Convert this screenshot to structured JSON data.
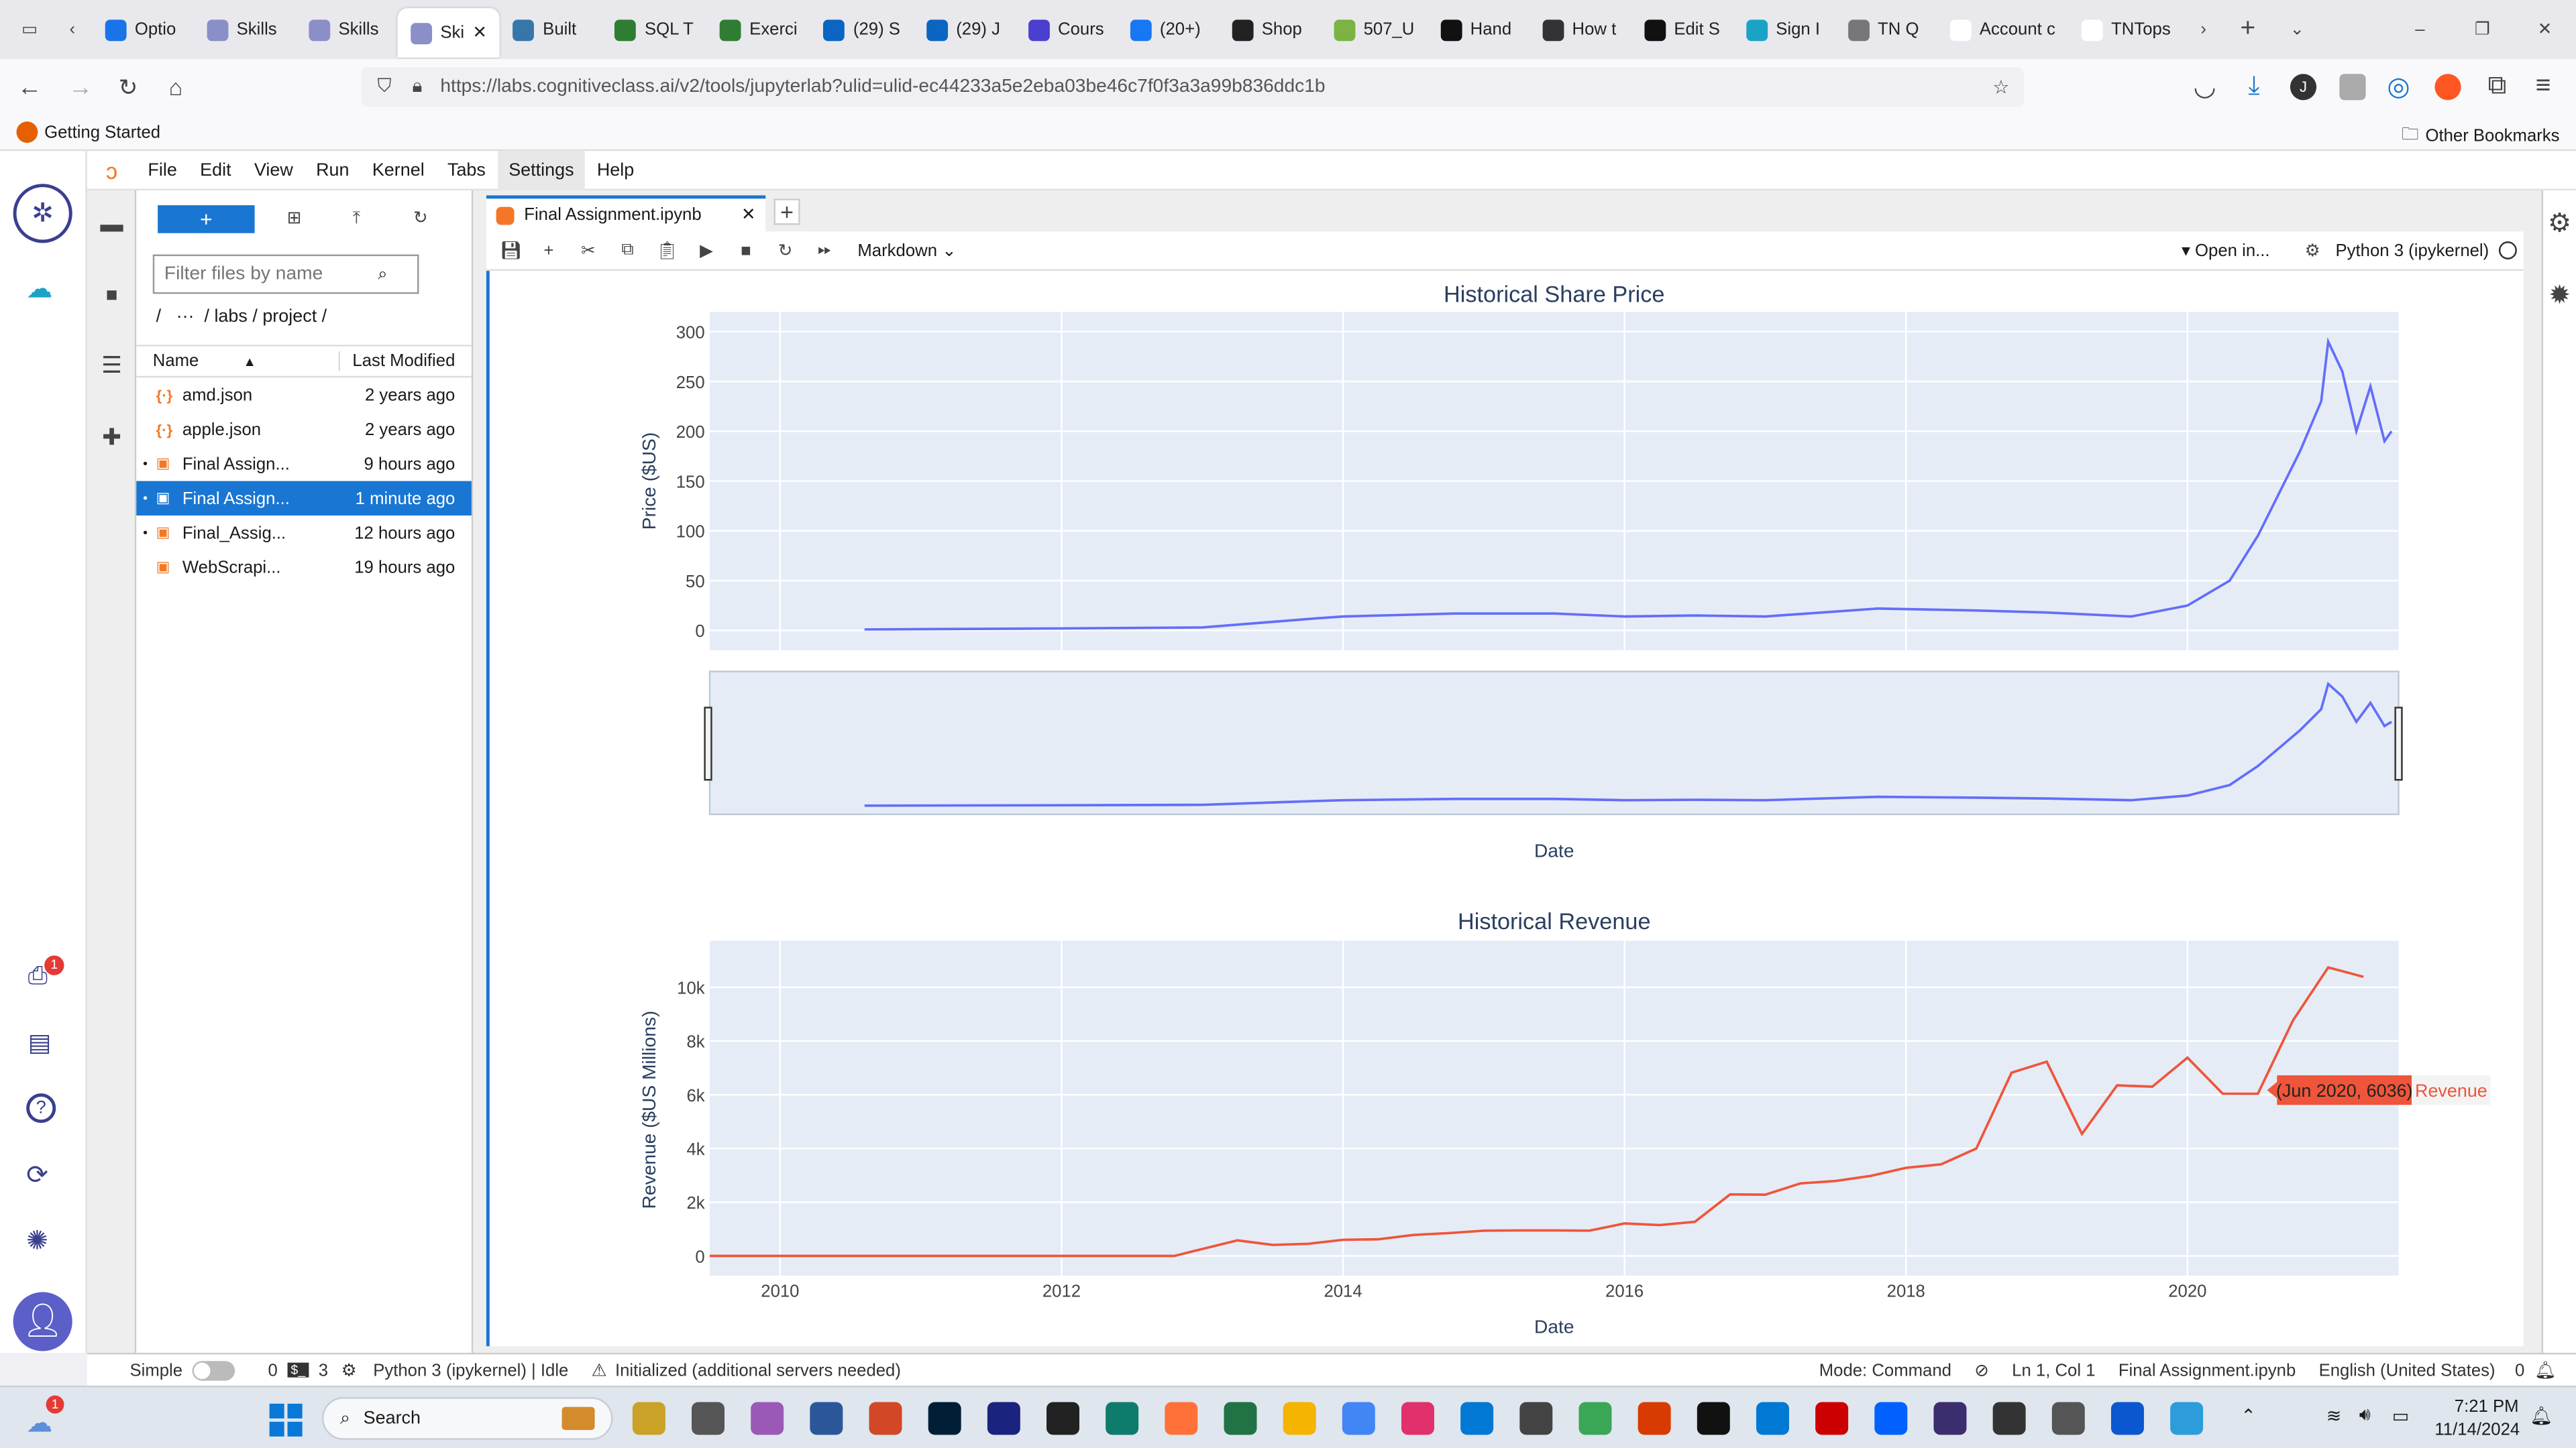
{
  "browser": {
    "tabs": [
      "Optio",
      "Skills",
      "Skills",
      "Ski",
      "Built",
      "SQL T",
      "Exerci",
      "(29) S",
      "(29) J",
      "Cours",
      "(20+)",
      "Shop",
      "507_U",
      "Hand",
      "How t",
      "Edit S",
      "Sign I",
      "TN Q",
      "Account c",
      "TNTops"
    ],
    "url": "https://labs.cognitiveclass.ai/v2/tools/jupyterlab?ulid=ulid-ec44233a5e2eba03be46c7f0f3a3a99b836ddc1b",
    "bookmark": "Getting Started",
    "other_bookmarks": "Other Bookmarks"
  },
  "menu": [
    "File",
    "Edit",
    "View",
    "Run",
    "Kernel",
    "Tabs",
    "Settings",
    "Help"
  ],
  "filebrowser": {
    "new_label": "+",
    "filter_placeholder": "Filter files by name",
    "breadcrumb": "/   ···  / labs / project /",
    "col_name": "Name",
    "col_modified": "Last Modified",
    "files": [
      {
        "name": "amd.json",
        "modified": "2 years ago",
        "kind": "json",
        "dot": false,
        "selected": false
      },
      {
        "name": "apple.json",
        "modified": "2 years ago",
        "kind": "json",
        "dot": false,
        "selected": false
      },
      {
        "name": "Final Assign...",
        "modified": "9 hours ago",
        "kind": "nb",
        "dot": true,
        "selected": false
      },
      {
        "name": "Final Assign...",
        "modified": "1 minute ago",
        "kind": "nb",
        "dot": true,
        "selected": true
      },
      {
        "name": "Final_Assig...",
        "modified": "12 hours ago",
        "kind": "nb",
        "dot": true,
        "selected": false
      },
      {
        "name": "WebScrapi...",
        "modified": "19 hours ago",
        "kind": "nb",
        "dot": false,
        "selected": false
      }
    ]
  },
  "notebook": {
    "tab_title": "Final Assignment.ipynb",
    "cell_type": "Markdown",
    "open_in": "Open in...",
    "kernel": "Python 3 (ipykernel)"
  },
  "status": {
    "mode": "Simple",
    "n0": "0",
    "n3": "3",
    "kernel": "Python 3 (ipykernel) | Idle",
    "init": "Initialized (additional servers needed)",
    "cmd": "Mode: Command",
    "pos": "Ln 1, Col 1",
    "file": "Final Assignment.ipynb",
    "lang": "English (United States)",
    "count": "0"
  },
  "taskbar": {
    "search": "Search",
    "time": "7:21 PM",
    "date": "11/14/2024",
    "badge": "1"
  },
  "appbar": {
    "badge": "1"
  },
  "chart_data": [
    {
      "type": "line",
      "title": "Historical Share Price",
      "ylabel": "Price ($US)",
      "xlabel": "Date",
      "x": [
        2010.6,
        2012.0,
        2013.0,
        2013.8,
        2014.0,
        2014.8,
        2015.5,
        2016.0,
        2016.5,
        2017.0,
        2017.8,
        2018.5,
        2019.0,
        2019.6,
        2020.0,
        2020.3,
        2020.5,
        2020.8,
        2020.95,
        2021.0,
        2021.1,
        2021.2,
        2021.3,
        2021.4,
        2021.45
      ],
      "values": [
        1,
        2,
        3,
        12,
        14,
        17,
        17,
        14,
        15,
        14,
        22,
        20,
        18,
        14,
        25,
        50,
        95,
        180,
        230,
        290,
        260,
        200,
        245,
        190,
        200
      ],
      "ylim": [
        0,
        300
      ],
      "xlim": [
        2009.5,
        2021.5
      ],
      "yticks": [
        0,
        50,
        100,
        150,
        200,
        250,
        300
      ],
      "color": "#636efa",
      "rangeslider": true
    },
    {
      "type": "line",
      "title": "Historical Revenue",
      "ylabel": "Revenue ($US Millions)",
      "xlabel": "Date",
      "x": [
        2009.5,
        2012.8,
        2013.25,
        2013.5,
        2013.75,
        2014.0,
        2014.25,
        2014.5,
        2014.75,
        2015.0,
        2015.25,
        2015.5,
        2015.75,
        2016.0,
        2016.25,
        2016.5,
        2016.75,
        2017.0,
        2017.25,
        2017.5,
        2017.75,
        2018.0,
        2018.25,
        2018.5,
        2018.75,
        2019.0,
        2019.25,
        2019.5,
        2019.75,
        2020.0,
        2020.25,
        2020.5,
        2020.75,
        2021.0,
        2021.25
      ],
      "values": [
        0,
        0,
        580,
        410,
        450,
        600,
        620,
        780,
        850,
        940,
        950,
        950,
        940,
        1210,
        1150,
        1270,
        2290,
        2280,
        2700,
        2790,
        2980,
        3280,
        3410,
        4000,
        6820,
        7230,
        4540,
        6350,
        6300,
        7380,
        6040,
        6036,
        8770,
        10740,
        10390
      ],
      "ylim": [
        0,
        11000
      ],
      "xlim": [
        2009.5,
        2021.5
      ],
      "yticks": [
        0,
        2000,
        4000,
        6000,
        8000,
        10000
      ],
      "ytick_labels": [
        "0",
        "2k",
        "4k",
        "6k",
        "8k",
        "10k"
      ],
      "xticks": [
        2010,
        2012,
        2014,
        2016,
        2018,
        2020
      ],
      "color": "#ef553b",
      "hover": {
        "label": "(Jun 2020, 6036)",
        "series": "Revenue"
      }
    }
  ]
}
